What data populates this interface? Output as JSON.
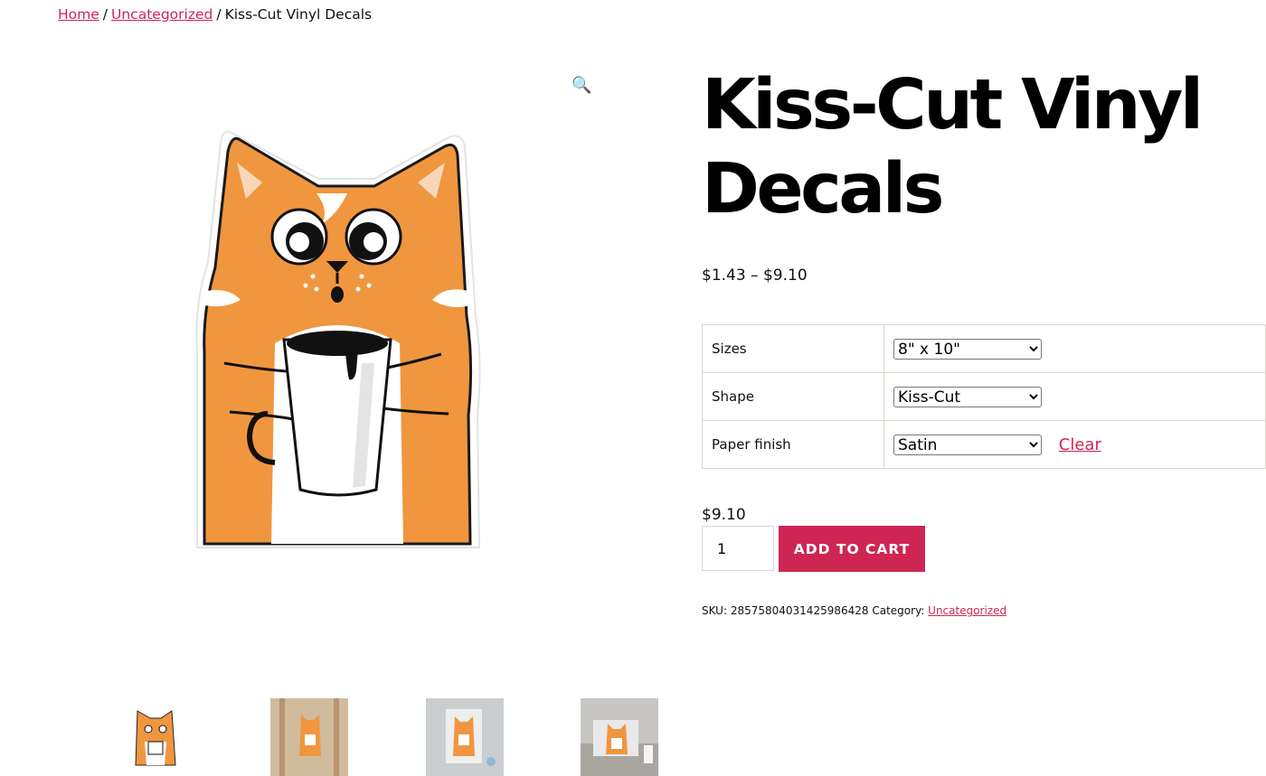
{
  "breadcrumb": {
    "home": "Home",
    "separator": "/",
    "category": "Uncategorized",
    "current": "Kiss-Cut Vinyl Decals"
  },
  "gallery": {
    "zoom_icon": "magnifier-icon",
    "zoom_glyph": "🔍",
    "thumbnails": [
      "sticker-cat",
      "sticker-on-door",
      "sticker-on-fridge",
      "sticker-on-laptop"
    ]
  },
  "product": {
    "title": "Kiss-Cut Vinyl Decals",
    "price_range": "$1.43 – $9.10",
    "variations": [
      {
        "label": "Sizes",
        "selected": "8\" x 10\""
      },
      {
        "label": "Shape",
        "selected": "Kiss-Cut"
      },
      {
        "label": "Paper finish",
        "selected": "Satin"
      }
    ],
    "clear_label": "Clear",
    "variation_price": "$9.10",
    "quantity": "1",
    "add_to_cart": "ADD TO CART",
    "sku_label": "SKU:",
    "sku": "28575804031425986428",
    "category_label": "Category:",
    "category": "Uncategorized"
  },
  "colors": {
    "accent": "#cd2653",
    "text": "#111111",
    "border": "#dcd7ca",
    "cat_orange": "#f0963f"
  }
}
